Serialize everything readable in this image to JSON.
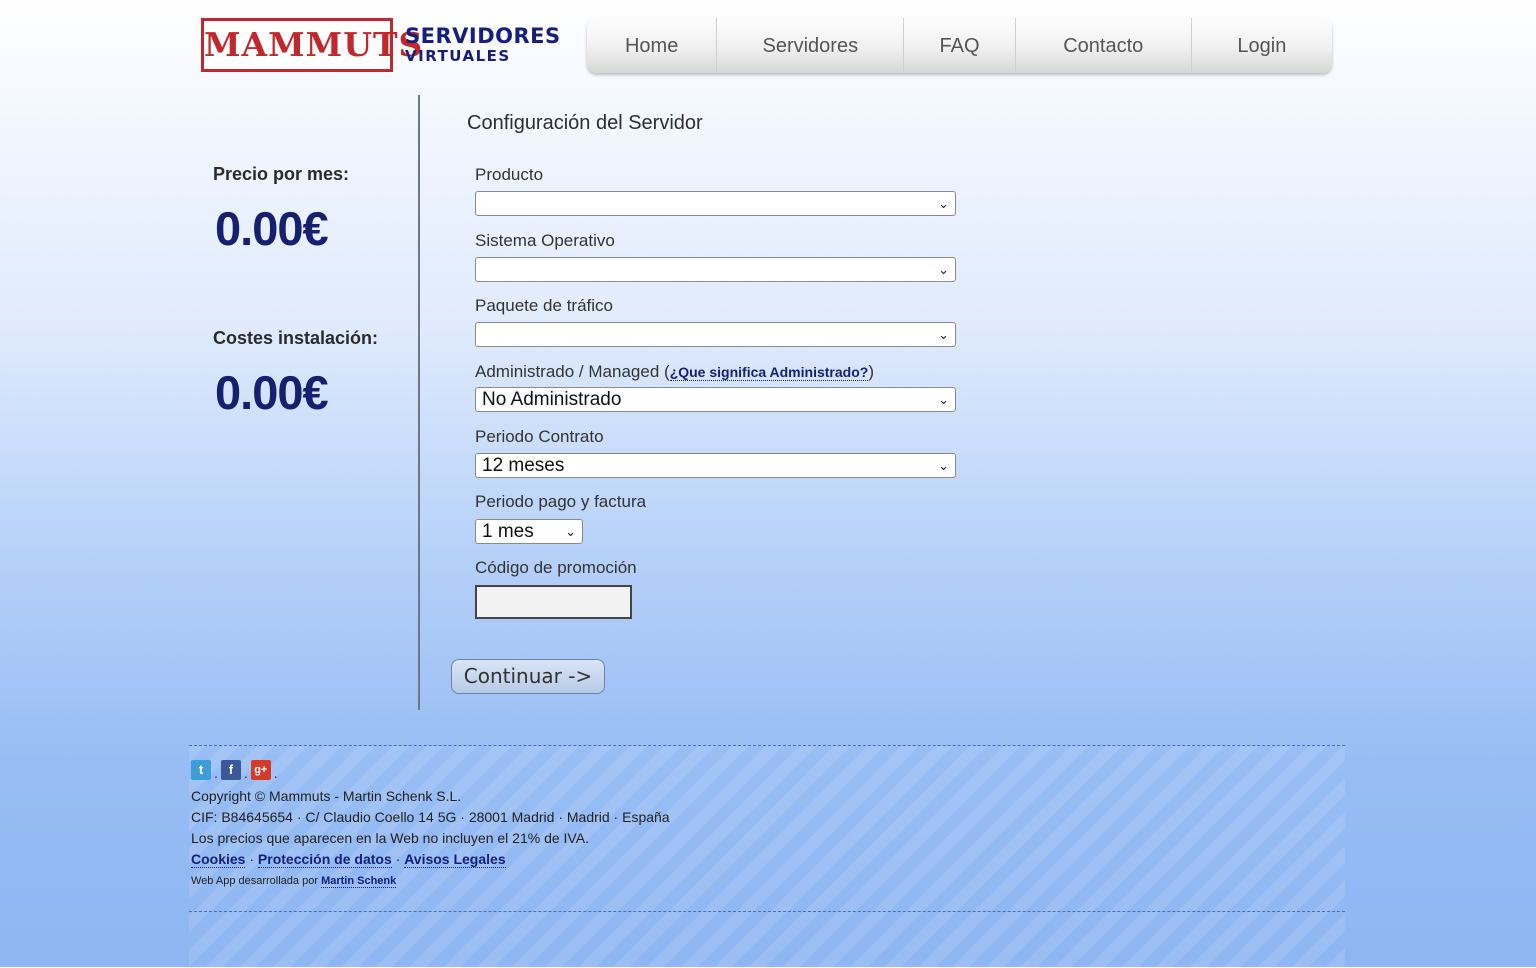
{
  "header": {
    "logo_stamp": "MAMMUTS",
    "logo_line1": "SERVIDORES",
    "logo_line2": "VIRTUALES",
    "nav": [
      "Home",
      "Servidores",
      "FAQ",
      "Contacto",
      "Login"
    ]
  },
  "sidebar": {
    "price_label": "Precio por mes:",
    "price_value": "0.00€",
    "setup_label": "Costes instalación:",
    "setup_value": "0.00€"
  },
  "form": {
    "title": "Configuración del Servidor",
    "product_label": "Producto",
    "product_value": "",
    "os_label": "Sistema Operativo",
    "os_value": "",
    "traffic_label": "Paquete de tráfico",
    "traffic_value": "",
    "managed_label": "Administrado / Managed",
    "managed_link": "¿Que significa Administrado?",
    "managed_value": "No Administrado",
    "contract_label": "Periodo Contrato",
    "contract_value": "12 meses",
    "billing_label": "Periodo pago y factura",
    "billing_value": "1 mes",
    "promo_label": "Código de promoción",
    "promo_value": "",
    "continue_label": "Continuar ->"
  },
  "footer": {
    "social_icons": [
      "twitter-icon",
      "facebook-icon",
      "google-plus-icon"
    ],
    "copyright": "Copyright © Mammuts - Martin Schenk S.L.",
    "address": "CIF: B84645654 · C/ Claudio Coello 14 5G · 28001 Madrid · Madrid · España",
    "vat_note": "Los precios que aparecen en la Web no incluyen el 21% de IVA.",
    "links": [
      "Cookies",
      "Protección de datos",
      "Avisos Legales"
    ],
    "credit_prefix": "Web App desarrollada por",
    "credit_link": "Martin Schenk"
  },
  "colors": {
    "brand_red": "#c0282e",
    "brand_navy": "#16207a",
    "price_navy": "#17206e"
  }
}
